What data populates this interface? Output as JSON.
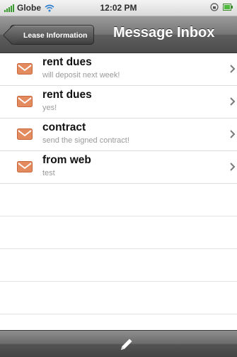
{
  "status_bar": {
    "carrier": "Globe",
    "time": "12:02 PM",
    "icons": [
      "signal-icon",
      "wifi-icon",
      "rotation-lock-icon",
      "battery-icon"
    ]
  },
  "nav": {
    "back_label": "Lease Information",
    "title": "Message Inbox"
  },
  "messages": [
    {
      "subject": "rent dues",
      "preview": "will deposit next week!"
    },
    {
      "subject": "rent dues",
      "preview": "yes!"
    },
    {
      "subject": "contract",
      "preview": "send the signed contract!"
    },
    {
      "subject": "from web",
      "preview": "test"
    }
  ],
  "toolbar": {
    "compose_icon": "compose-pencil-icon"
  },
  "colors": {
    "mail_icon": "#e07a4f",
    "nav_bar": "#5e5e5e",
    "preview_text": "#9a9a9a"
  }
}
